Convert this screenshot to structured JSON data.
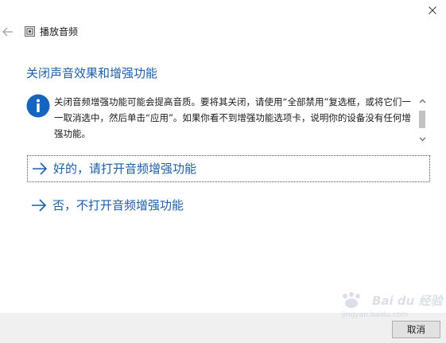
{
  "window": {
    "title": "播放音频"
  },
  "page": {
    "heading": "关闭声音效果和增强功能",
    "info_text": "关闭音频增强功能可能会提高音质。要将其关闭，请使用“全部禁用”复选框，或将它们一一取消选中，然后单击“应用”。如果你看不到增强功能选项卡，说明你的设备没有任何增强功能。"
  },
  "options": {
    "yes_label": "好的，请打开音频增强功能",
    "no_label": "否，不打开音频增强功能"
  },
  "footer": {
    "cancel_label": "取消"
  },
  "watermark": {
    "brand": "Bai du 经验",
    "url": "jingyan.baidu.com"
  },
  "colors": {
    "accent": "#1e5fa8",
    "info_icon": "#1565c0",
    "footer_bg": "#f0f0f0"
  },
  "icons": {
    "close": "close-icon",
    "back": "back-arrow-icon",
    "app": "speaker-icon",
    "info": "info-icon",
    "option_arrow": "right-arrow-icon"
  }
}
